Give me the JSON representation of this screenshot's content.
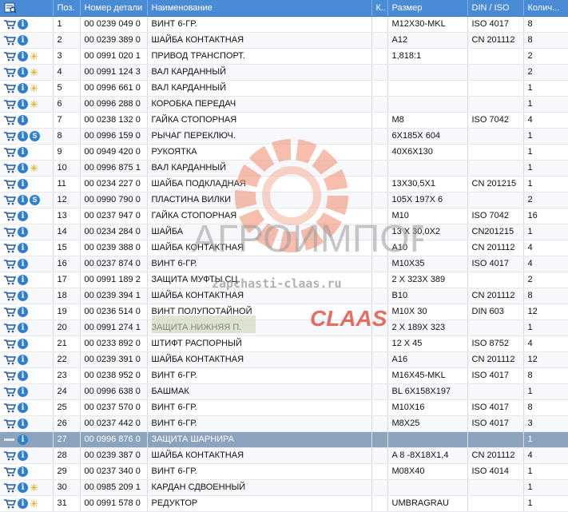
{
  "columns": [
    "",
    "Поз.",
    "Номер детали",
    "Наименование",
    "К..",
    "Размер",
    "DIN / ISO",
    "Колич..."
  ],
  "rows": [
    {
      "pos": "1",
      "part": "00 0239 049 0",
      "name": "ВИНТ 6-ГР.",
      "size": "M12X30-MKL",
      "din": "ISO 4017",
      "qty": "8",
      "badge": "none"
    },
    {
      "pos": "2",
      "part": "00 0239 389 0",
      "name": "ШАЙБА КОНТАКТНАЯ",
      "size": "A12",
      "din": "CN 201112",
      "qty": "8",
      "badge": "none"
    },
    {
      "pos": "3",
      "part": "00 0991 020 1",
      "name": "ПРИВОД ТРАНСПОРТ.",
      "size": "1,818:1",
      "din": "",
      "qty": "2",
      "badge": "star"
    },
    {
      "pos": "4",
      "part": "00 0991 124 3",
      "name": "ВАЛ КАРДАННЫЙ",
      "size": "",
      "din": "",
      "qty": "2",
      "badge": "star"
    },
    {
      "pos": "5",
      "part": "00 0996 661 0",
      "name": "ВАЛ КАРДАННЫЙ",
      "size": "",
      "din": "",
      "qty": "1",
      "badge": "star"
    },
    {
      "pos": "6",
      "part": "00 0996 288 0",
      "name": "КОРОБКА ПЕРЕДАЧ",
      "size": "",
      "din": "",
      "qty": "1",
      "badge": "star"
    },
    {
      "pos": "7",
      "part": "00 0238 132 0",
      "name": "ГАЙКА СТОПОРНАЯ",
      "size": "M8",
      "din": "ISO 7042",
      "qty": "4",
      "badge": "none"
    },
    {
      "pos": "8",
      "part": "00 0996 159 0",
      "name": "РЫЧАГ ПЕРЕКЛЮЧ.",
      "size": "6X185X 604",
      "din": "",
      "qty": "1",
      "badge": "s"
    },
    {
      "pos": "9",
      "part": "00 0949 420 0",
      "name": "РУКОЯТКА",
      "size": "40X6X130",
      "din": "",
      "qty": "1",
      "badge": "none"
    },
    {
      "pos": "10",
      "part": "00 0996 875 1",
      "name": "ВАЛ КАРДАННЫЙ",
      "size": "",
      "din": "",
      "qty": "1",
      "badge": "star"
    },
    {
      "pos": "11",
      "part": "00 0234 227 0",
      "name": "ШАЙБА ПОДКЛАДНАЯ",
      "size": "13X30,5X1",
      "din": "CN 201215",
      "qty": "1",
      "badge": "none"
    },
    {
      "pos": "12",
      "part": "00 0990 790 0",
      "name": "ПЛАСТИНА ВИЛКИ",
      "size": "105X 197X 6",
      "din": "",
      "qty": "2",
      "badge": "s"
    },
    {
      "pos": "13",
      "part": "00 0237 947 0",
      "name": "ГАЙКА СТОПОРНАЯ",
      "size": "M10",
      "din": "ISO 7042",
      "qty": "16",
      "badge": "none"
    },
    {
      "pos": "14",
      "part": "00 0234 284 0",
      "name": "ШАЙБА",
      "size": "13  X 30,0X2",
      "din": "CN201215",
      "qty": "1",
      "badge": "none"
    },
    {
      "pos": "15",
      "part": "00 0239 388 0",
      "name": "ШАЙБА КОНТАКТНАЯ",
      "size": "A10",
      "din": "CN 201112",
      "qty": "4",
      "badge": "none"
    },
    {
      "pos": "16",
      "part": "00 0237 874 0",
      "name": "ВИНТ 6-ГР.",
      "size": "M10X35",
      "din": "ISO 4017",
      "qty": "4",
      "badge": "none"
    },
    {
      "pos": "17",
      "part": "00 0991 189 2",
      "name": "ЗАЩИТА МУФТЫ СЦ.",
      "size": "2 X 323X 389",
      "din": "",
      "qty": "2",
      "badge": "none"
    },
    {
      "pos": "18",
      "part": "00 0239 394 1",
      "name": "ШАЙБА КОНТАКТНАЯ",
      "size": "B10",
      "din": "CN 201112",
      "qty": "8",
      "badge": "none"
    },
    {
      "pos": "19",
      "part": "00 0236 514 0",
      "name": "ВИНТ ПОЛУПОТАЙНОЙ",
      "size": "M10X 30",
      "din": "DIN 603",
      "qty": "12",
      "badge": "none"
    },
    {
      "pos": "20",
      "part": "00 0991 274 1",
      "name": "ЗАЩИТА НИЖНЯЯ П.",
      "size": "2 X 189X 323",
      "din": "",
      "qty": "1",
      "badge": "none"
    },
    {
      "pos": "21",
      "part": "00 0233 892 0",
      "name": "ШТИФТ РАСПОРНЫЙ",
      "size": "12  X 45",
      "din": "ISO 8752",
      "qty": "4",
      "badge": "none"
    },
    {
      "pos": "22",
      "part": "00 0239 391 0",
      "name": "ШАЙБА КОНТАКТНАЯ",
      "size": "A16",
      "din": "CN 201112",
      "qty": "12",
      "badge": "none"
    },
    {
      "pos": "23",
      "part": "00 0238 952 0",
      "name": "ВИНТ 6-ГР.",
      "size": "M16X45-MKL",
      "din": "ISO 4017",
      "qty": "8",
      "badge": "none"
    },
    {
      "pos": "24",
      "part": "00 0996 638 0",
      "name": "БАШМАК",
      "size": "BL 6X158X197",
      "din": "",
      "qty": "1",
      "badge": "none"
    },
    {
      "pos": "25",
      "part": "00 0237 570 0",
      "name": "ВИНТ 6-ГР.",
      "size": "M10X16",
      "din": "ISO 4017",
      "qty": "8",
      "badge": "none"
    },
    {
      "pos": "26",
      "part": "00 0237 442 0",
      "name": "ВИНТ 6-ГР.",
      "size": "M8X25",
      "din": "ISO 4017",
      "qty": "3",
      "badge": "none"
    },
    {
      "pos": "27",
      "part": "00 0996 876 0",
      "name": "ЗАЩИТА ШАРНИРА",
      "size": "",
      "din": "",
      "qty": "1",
      "badge": "none",
      "selected": true
    },
    {
      "pos": "28",
      "part": "00 0239 387 0",
      "name": "ШАЙБА КОНТАКТНАЯ",
      "size": "A 8 -8X18X1,4",
      "din": "CN 201112",
      "qty": "4",
      "badge": "none"
    },
    {
      "pos": "29",
      "part": "00 0237 340 0",
      "name": "ВИНТ 6-ГР.",
      "size": "M08X40",
      "din": "ISO 4014",
      "qty": "1",
      "badge": "none"
    },
    {
      "pos": "30",
      "part": "00 0985 209 1",
      "name": "КАРДАН СДВОЕННЫЙ",
      "size": "",
      "din": "",
      "qty": "1",
      "badge": "star"
    },
    {
      "pos": "31",
      "part": "00 0991 578 0",
      "name": "РЕДУКТОР",
      "size": "UMBRAGRAU",
      "din": "",
      "qty": "1",
      "badge": "star"
    }
  ],
  "watermark": {
    "brand": "АГРОИМПОРТ",
    "site": "zapchasti-claas.ru",
    "logo": "CLAAS",
    "brand_color": "#9a9a9a",
    "accent_color": "#e0301e"
  },
  "colors": {
    "header_bg": "#4a8bd6",
    "selected_bg": "#8ca3be",
    "info_icon": "#2f7fd1",
    "star_icon": "#e7a200"
  }
}
